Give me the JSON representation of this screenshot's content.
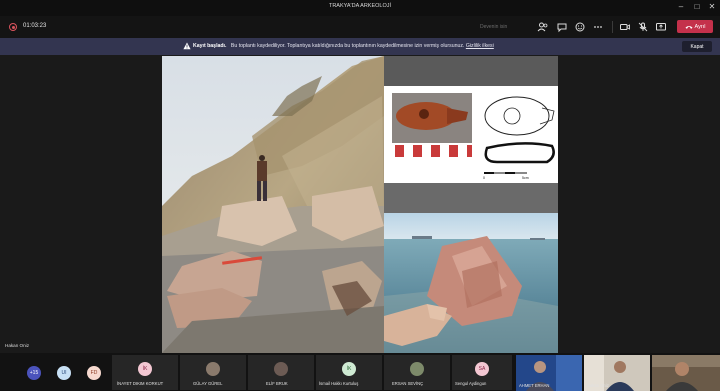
{
  "window": {
    "title": "TRAKYA'DA ARKEOLOJİ",
    "minimize_icon": "minimize-icon",
    "maximize_icon": "maximize-icon",
    "close_icon": "close-icon"
  },
  "toolbar": {
    "timer": "01:03:23",
    "status_text": "Devenin isin",
    "leave_label": "Ayrıl",
    "icons": [
      "participants-icon",
      "chat-icon",
      "reactions-icon",
      "breakout-icon",
      "more-icon",
      "camera-icon",
      "mic-icon",
      "share-icon"
    ]
  },
  "banner": {
    "title": "Kayıt başladı.",
    "message": "Bu toplantı kaydediliyor. Toplantıya katıldığınızda bu toplantının kaydedilmesine izin vermiş olursunuz.",
    "link": "Gizlilik ilkesi",
    "close_label": "Kapat"
  },
  "presenter": {
    "name": "Hakan Oniz"
  },
  "shared_content": {
    "scale_labels": [
      "0",
      "5cm"
    ]
  },
  "participants": [
    {
      "initials": "+15",
      "color": "#4b53bc"
    },
    {
      "initials": "UI",
      "color": "#c8e0f5",
      "text_color": "#2a4a7a"
    },
    {
      "initials": "FD",
      "color": "#f6d9cf",
      "text_color": "#8a3a22"
    },
    {
      "initials": "İK",
      "name": "İNAYET DIKIM KORKUT",
      "color": "#f3c7d2",
      "text_color": "#8a2445"
    },
    {
      "initials": "",
      "name": "GÜLAY GÜREL",
      "color": "#8a7a6c"
    },
    {
      "initials": "",
      "name": "ELİF BRUK",
      "color": "#6c5b54"
    },
    {
      "initials": "İK",
      "name": "İsmail Hakkı Kurtuluş",
      "color": "#cfead3",
      "text_color": "#2f6a3a"
    },
    {
      "initials": "",
      "name": "ERSAN SEVİNÇ",
      "color": "#7d8a6a"
    },
    {
      "initials": "SA",
      "name": "Sengul Aydingun",
      "color": "#f3c7d2",
      "text_color": "#8a2445"
    },
    {
      "name": "AHMET ERHAN"
    },
    {
      "name": "Hakan Oniz"
    },
    {
      "name": ""
    }
  ]
}
